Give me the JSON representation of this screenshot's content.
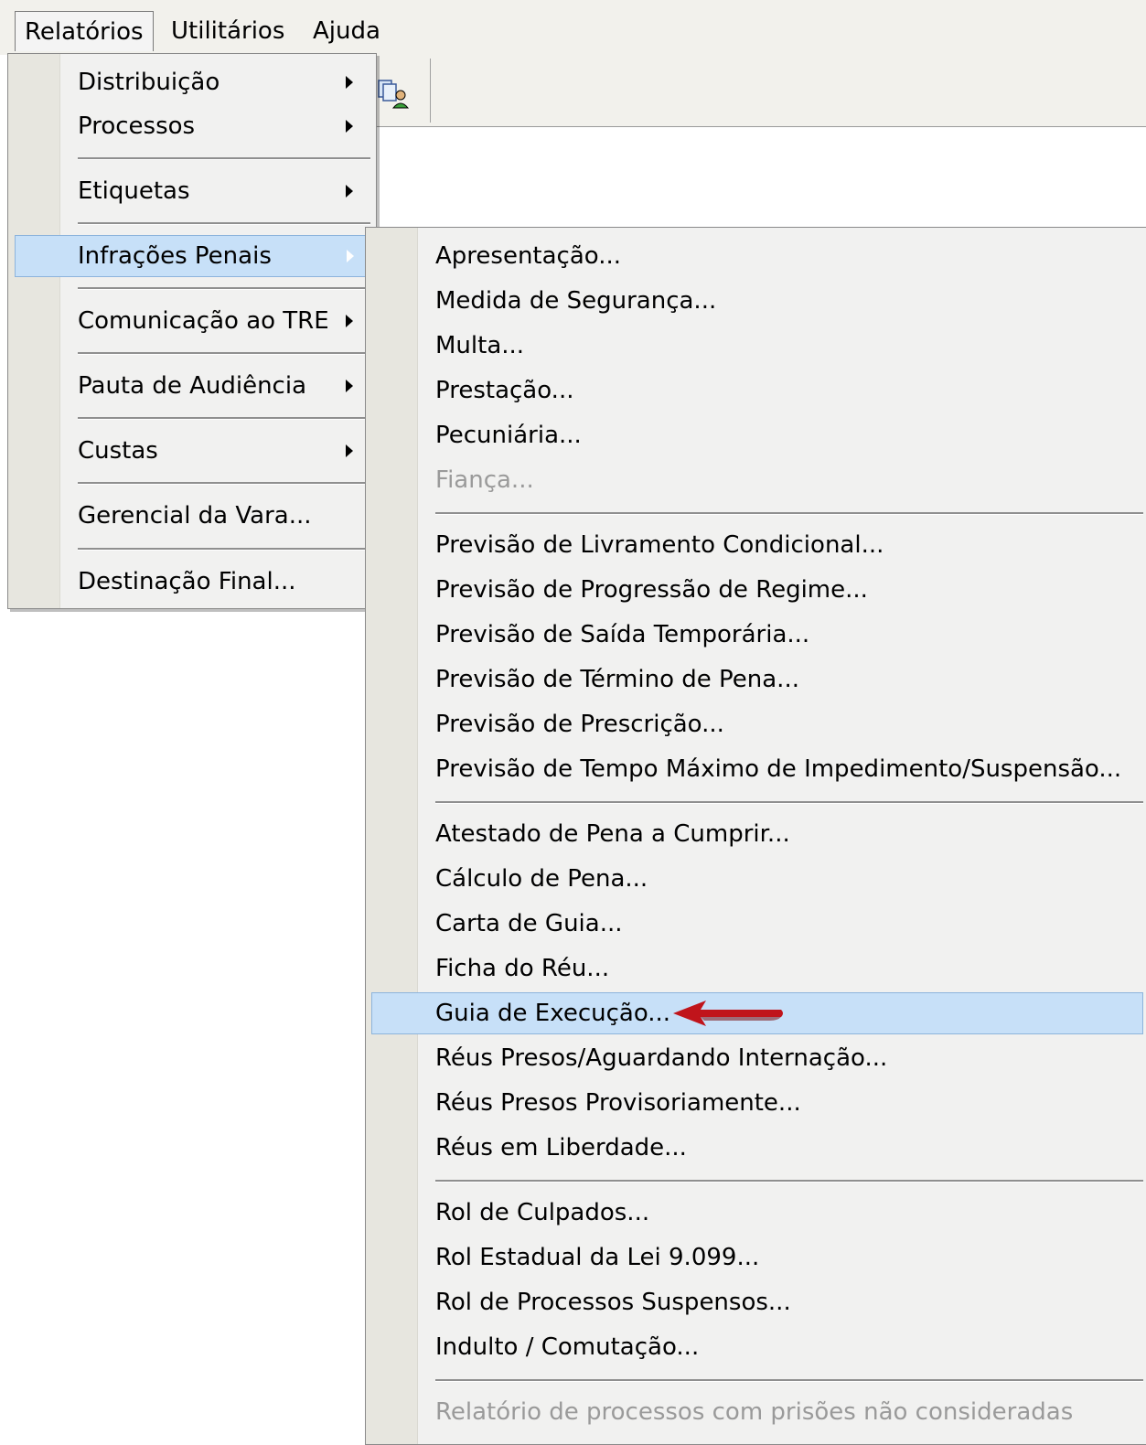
{
  "menubar": {
    "items": [
      {
        "label": "Relatórios"
      },
      {
        "label": "Utilitários"
      },
      {
        "label": "Ajuda"
      }
    ]
  },
  "relatorios_menu": {
    "items": [
      {
        "label": "Distribuição",
        "submenu": true
      },
      {
        "label": "Processos",
        "submenu": true
      },
      {
        "label": "Etiquetas",
        "submenu": true
      },
      {
        "label": "Infrações Penais",
        "submenu": true,
        "highlighted": true
      },
      {
        "label": "Comunicação ao TRE",
        "submenu": true
      },
      {
        "label": "Pauta de Audiência",
        "submenu": true
      },
      {
        "label": "Custas",
        "submenu": true
      },
      {
        "label": "Gerencial da Vara...",
        "submenu": false
      },
      {
        "label": "Destinação Final...",
        "submenu": false
      }
    ]
  },
  "infracoes_submenu": {
    "items": [
      {
        "label": "Apresentação..."
      },
      {
        "label": "Medida de Segurança..."
      },
      {
        "label": "Multa..."
      },
      {
        "label": "Prestação..."
      },
      {
        "label": "Pecuniária..."
      },
      {
        "label": "Fiança...",
        "disabled": true
      },
      {
        "label": "Previsão de Livramento Condicional..."
      },
      {
        "label": "Previsão de Progressão de Regime..."
      },
      {
        "label": "Previsão de Saída Temporária..."
      },
      {
        "label": "Previsão de Término de Pena..."
      },
      {
        "label": "Previsão de Prescrição..."
      },
      {
        "label": "Previsão de Tempo Máximo de Impedimento/Suspensão..."
      },
      {
        "label": "Atestado de Pena a Cumprir..."
      },
      {
        "label": "Cálculo de Pena..."
      },
      {
        "label": "Carta de Guia..."
      },
      {
        "label": "Ficha do Réu..."
      },
      {
        "label": "Guia de Execução...",
        "highlighted": true
      },
      {
        "label": "Réus Presos/Aguardando Internação..."
      },
      {
        "label": "Réus Presos Provisoriamente..."
      },
      {
        "label": "Réus em Liberdade..."
      },
      {
        "label": "Rol de Culpados..."
      },
      {
        "label": "Rol Estadual da Lei 9.099..."
      },
      {
        "label": "Rol de Processos Suspensos..."
      },
      {
        "label": "Indulto / Comutação..."
      },
      {
        "label": "Relatório de processos com prisões não consideradas",
        "disabled": true
      }
    ]
  },
  "icons": {
    "toolbar_icon": "users-copy-icon",
    "annotation": "red-arrow-icon",
    "submenu_arrow": "chevron-right-icon"
  },
  "colors": {
    "highlight": "#c7e0f8",
    "annotation": "#c0141b"
  }
}
